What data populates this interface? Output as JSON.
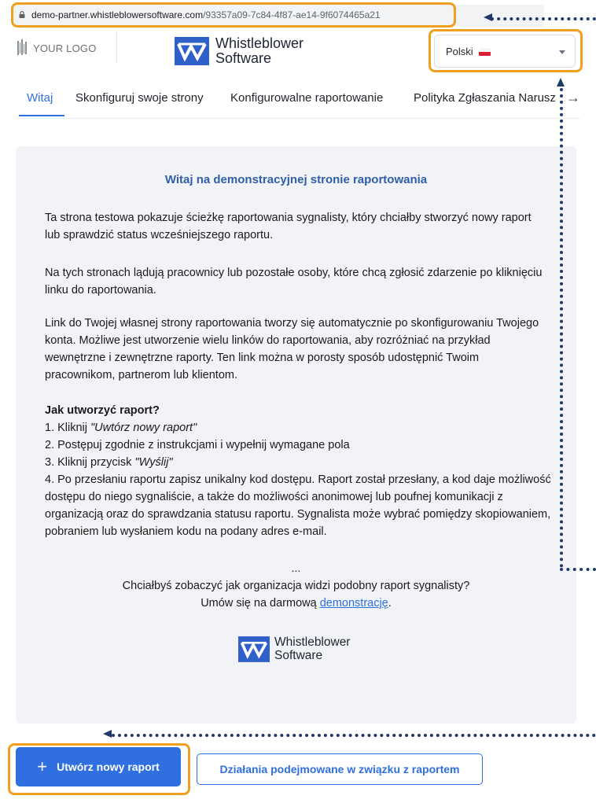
{
  "browser": {
    "url_host": "demo-partner.whistleblowersoftware.com",
    "url_path": "/93357a09-7c84-4f87-ae14-9f6074465a21"
  },
  "header": {
    "your_logo": "YOUR LOGO",
    "brand_line1": "Whistleblower",
    "brand_line2": "Software",
    "language": "Polski",
    "colors": {
      "brand_blue": "#2f6fe0",
      "highlight": "#f0a020"
    }
  },
  "tabs": [
    {
      "label": "Witaj",
      "active": true
    },
    {
      "label": "Skonfiguruj swoje strony",
      "active": false
    },
    {
      "label": "Konfigurowalne raportowanie",
      "active": false
    },
    {
      "label": "Polityka Zgłaszania Narusz",
      "active": false
    }
  ],
  "content": {
    "title": "Witaj na demonstracyjnej stronie raportowania",
    "p1": "Ta strona testowa pokazuje ścieżkę raportowania sygnalisty, który chciałby stworzyć nowy raport lub sprawdzić status wcześniejszego raportu.",
    "p2": "Na tych stronach lądują pracownicy lub pozostałe osoby, które chcą zgłosić zdarzenie po kliknięciu linku do raportowania.",
    "p3": "Link do Twojej własnej strony raportowania tworzy się automatycznie po skonfigurowaniu Twojego konta. Możliwe jest utworzenie wielu linków do raportowania, aby rozróżniać na przykład wewnętrzne i zewnętrzne raporty. Ten link można w porosty sposób udostępnić Twoim pracownikom, partnerom lub klientom.",
    "howto_heading": "Jak utworzyć raport?",
    "step1_prefix": "1. Kliknij ",
    "step1_em": "\"Uwtórz nowy raport\"",
    "step2": "2. Postępuj zgodnie z instrukcjami i wypełnij wymagane pola",
    "step3_prefix": "3. Kliknij przycisk ",
    "step3_em": "\"Wyślij\"",
    "step4": "4. Po przesłaniu raportu zapisz unikalny kod dostępu. Raport został przesłany, a kod daje możliwość dostępu do niego sygnaliście, a także do możliwości anonimowej lub poufnej komunikacji z organizacją oraz do sprawdzania statusu raportu. Sygnalista może wybrać pomiędzy skopiowaniem, pobraniem lub wysłaniem kodu na podany adres e-mail.",
    "ellipsis": "...",
    "cta_line1": "Chciałbyś zobaczyć jak organizacja widzi podobny raport sygnalisty?",
    "cta_line2_prefix": "Umów się na darmową ",
    "cta_link": "demonstrację",
    "cta_line2_suffix": ".",
    "brand_line1": "Whistleblower",
    "brand_line2": "Software"
  },
  "actions": {
    "create_report": "Utwórz nowy raport",
    "follow_up": "Działania podejmowane w związku z raportem"
  }
}
